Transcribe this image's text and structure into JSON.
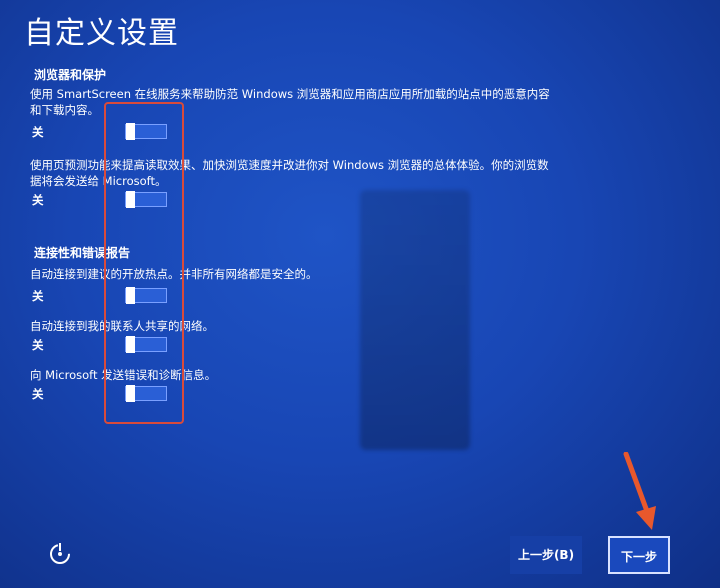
{
  "page": {
    "title": "自定义设置"
  },
  "sections": [
    {
      "title": "浏览器和保护",
      "settings": [
        {
          "desc": "使用 SmartScreen 在线服务来帮助防范 Windows 浏览器和应用商店应用所加载的站点中的恶意内容和下载内容。",
          "state": "关",
          "on": false
        },
        {
          "desc": "使用页预测功能来提高读取效果、加快浏览速度并改进你对 Windows 浏览器的总体体验。你的浏览数据将会发送给 Microsoft。",
          "state": "关",
          "on": false
        }
      ]
    },
    {
      "title": "连接性和错误报告",
      "settings": [
        {
          "desc": "自动连接到建议的开放热点。并非所有网络都是安全的。",
          "state": "关",
          "on": false
        },
        {
          "desc": "自动连接到我的联系人共享的网络。",
          "state": "关",
          "on": false
        },
        {
          "desc": "向 Microsoft 发送错误和诊断信息。",
          "state": "关",
          "on": false
        }
      ]
    }
  ],
  "footer": {
    "back_label": "上一步(B)",
    "next_label": "下一步"
  },
  "colors": {
    "background": "#1846b4",
    "highlight_box": "#d84b3b",
    "arrow": "#e8582c"
  },
  "icons": {
    "accessibility": "accessibility-icon"
  }
}
